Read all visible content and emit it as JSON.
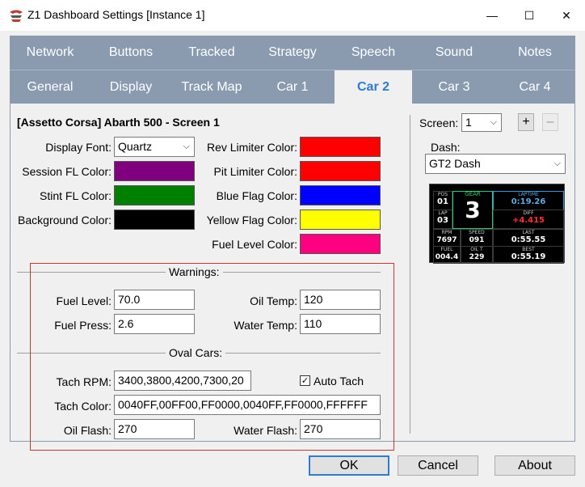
{
  "window": {
    "title": "Z1 Dashboard Settings [Instance 1]",
    "minimize": "—",
    "maximize": "☐",
    "close": "✕"
  },
  "tabs_row1": [
    "Network",
    "Buttons",
    "Tracked",
    "Strategy",
    "Speech",
    "Sound",
    "Notes"
  ],
  "tabs_row2": [
    "General",
    "Display",
    "Track Map",
    "Car 1",
    "Car 2",
    "Car 3",
    "Car 4"
  ],
  "active_tab": "Car 2",
  "car": {
    "heading": "[Assetto Corsa] Abarth 500 - Screen 1",
    "display_font_label": "Display Font:",
    "display_font_value": "Quartz",
    "session_fl_label": "Session FL Color:",
    "stint_fl_label": "Stint FL Color:",
    "background_label": "Background Color:",
    "rev_limiter_label": "Rev Limiter Color:",
    "pit_limiter_label": "Pit Limiter Color:",
    "blue_flag_label": "Blue Flag Color:",
    "yellow_flag_label": "Yellow Flag Color:",
    "fuel_level_color_label": "Fuel Level Color:"
  },
  "colors": {
    "session_fl": "#800080",
    "stint_fl": "#008000",
    "background": "#000000",
    "rev_limiter": "#ff0000",
    "pit_limiter": "#ff0000",
    "blue_flag": "#0000ff",
    "yellow_flag": "#ffff00",
    "fuel_level": "#ff0080"
  },
  "warnings": {
    "title": "Warnings:",
    "fuel_level_label": "Fuel Level:",
    "fuel_level_value": "70.0",
    "fuel_press_label": "Fuel Press:",
    "fuel_press_value": "2.6",
    "oil_temp_label": "Oil Temp:",
    "oil_temp_value": "120",
    "water_temp_label": "Water Temp:",
    "water_temp_value": "110"
  },
  "oval": {
    "title": "Oval Cars:",
    "tach_rpm_label": "Tach RPM:",
    "tach_rpm_value": "3400,3800,4200,7300,20",
    "auto_tach_label": "Auto Tach",
    "auto_tach_checked": "✓",
    "tach_color_label": "Tach Color:",
    "tach_color_value": "0040FF,00FF00,FF0000,0040FF,FF0000,FFFFFF",
    "oil_flash_label": "Oil Flash:",
    "oil_flash_value": "270",
    "water_flash_label": "Water Flash:",
    "water_flash_value": "270"
  },
  "screen": {
    "label": "Screen:",
    "value": "1",
    "add": "+",
    "remove": "–",
    "dash_label": "Dash:",
    "dash_value": "GT2 Dash"
  },
  "preview": {
    "pos_cap": "POS",
    "pos_val": "01",
    "lap_cap": "LAP",
    "lap_val": "03",
    "gear_cap": "GEAR",
    "gear_val": "3",
    "laptime_cap": "LAPTIME",
    "laptime_val": "0:19.26",
    "diff_cap": "DIFF",
    "diff_val": "+4.415",
    "rpm_cap": "RPM",
    "rpm_val": "7697",
    "speed_cap": "SPEED",
    "speed_val": "091",
    "last_cap": "LAST",
    "last_val": "0:55.55",
    "fuel_cap": "FUEL",
    "fuel_val": "004.4",
    "oilt_cap": "OIL T",
    "oilt_val": "229",
    "best_cap": "BEST",
    "best_val": "0:55.19"
  },
  "buttons": {
    "ok": "OK",
    "cancel": "Cancel",
    "about": "About"
  }
}
